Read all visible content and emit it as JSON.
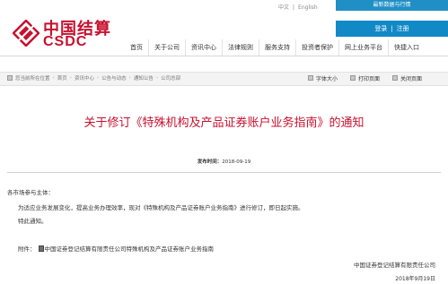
{
  "header": {
    "logo_cn": "中国结算",
    "logo_en": "CSDC",
    "lang_cn": "中文",
    "lang_sep": "|",
    "lang_en": "English",
    "top_banner": "最新数据与行情",
    "login": "登录",
    "login_sep": "|",
    "register": "注册",
    "brand_color": "#c8102e",
    "accent_color": "#1289c7"
  },
  "nav": {
    "items": [
      "首页",
      "关于公司",
      "资讯中心",
      "法律规则",
      "服务支持",
      "投资者保护",
      "网上业务平台",
      "快捷入口"
    ]
  },
  "breadcrumb": {
    "prefix": "您当前所在位置",
    "items": [
      "首页",
      "资讯中心",
      "公告与动态",
      "通知公告",
      "公司总部"
    ]
  },
  "tools": {
    "font_size": "字体大小",
    "print": "打印页面",
    "close": "关闭页面"
  },
  "article": {
    "title": "关于修订《特殊机构及产品证券账户业务指南》的通知",
    "date_label": "发布时间：",
    "date_value": "2018-09-19",
    "salutation": "各市场参与主体：",
    "body1": "为适应业务发展变化，提高业务办理效率，现对《特殊机构及产品证券账户业务指南》进行修订，即日起实施。",
    "body2": "特此通知。",
    "attachment_label": "附件：",
    "attachment_name": "中国证券登记结算有限责任公司特殊机构及产品证券账户业务指南",
    "signature": "中国证券登记结算有限责任公司",
    "sign_date": "2018年9月19日"
  }
}
